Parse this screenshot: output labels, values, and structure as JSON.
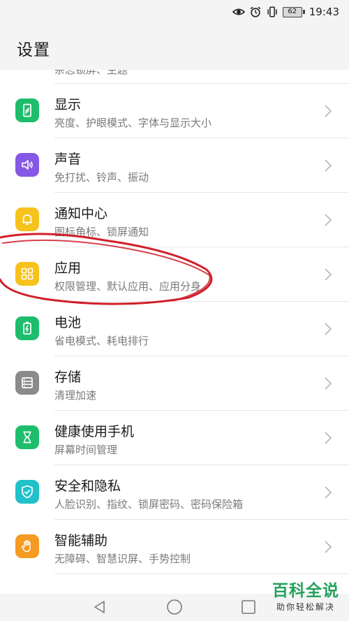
{
  "status_bar": {
    "battery_level": "62",
    "time": "19:43"
  },
  "header": {
    "title": "设置"
  },
  "partial_row": {
    "subtitle": "杂志锁屏、主题"
  },
  "items": [
    {
      "title": "显示",
      "subtitle": "亮度、护眼模式、字体与显示大小",
      "icon": "display-icon",
      "color": "#1ebd6c"
    },
    {
      "title": "声音",
      "subtitle": "免打扰、铃声、振动",
      "icon": "speaker-icon",
      "color": "#8658e6"
    },
    {
      "title": "通知中心",
      "subtitle": "图标角标、锁屏通知",
      "icon": "bell-icon",
      "color": "#f6c21c"
    },
    {
      "title": "应用",
      "subtitle": "权限管理、默认应用、应用分身",
      "icon": "apps-grid-icon",
      "color": "#f6c21c"
    },
    {
      "title": "电池",
      "subtitle": "省电模式、耗电排行",
      "icon": "battery-icon",
      "color": "#1ebd6c"
    },
    {
      "title": "存储",
      "subtitle": "清理加速",
      "icon": "storage-icon",
      "color": "#8a8a8a"
    },
    {
      "title": "健康使用手机",
      "subtitle": "屏幕时间管理",
      "icon": "hourglass-icon",
      "color": "#1ebd6c"
    },
    {
      "title": "安全和隐私",
      "subtitle": "人脸识别、指纹、锁屏密码、密码保险箱",
      "icon": "shield-check-icon",
      "color": "#20c1c9"
    },
    {
      "title": "智能辅助",
      "subtitle": "无障碍、智慧识屏、手势控制",
      "icon": "hand-icon",
      "color": "#f59a23"
    }
  ],
  "nav_bar": {
    "back": "back-icon",
    "home": "home-icon",
    "recents": "recents-icon"
  },
  "watermark": {
    "main": "百科全说",
    "sub": "助你轻松解决"
  }
}
